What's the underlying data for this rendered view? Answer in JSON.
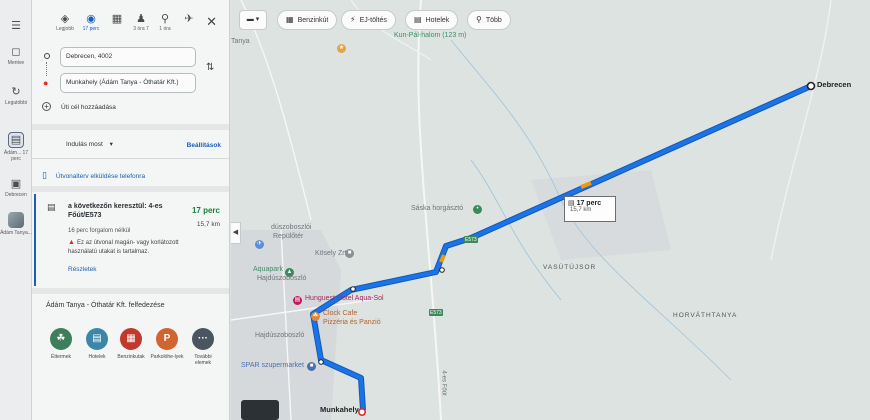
{
  "rail": {
    "items": [
      {
        "icon": "menu-icon",
        "label": ""
      },
      {
        "icon": "bookmark-icon",
        "label": "Mentve"
      },
      {
        "icon": "history-icon",
        "label": "Legutóbbi"
      },
      {
        "icon": "car-icon",
        "label": "Ádám... 17 perc"
      },
      {
        "icon": "car-icon",
        "label": "Debrecen"
      },
      {
        "icon": "thumbnail-icon",
        "label": "Ádám Tanya..."
      }
    ]
  },
  "modes": [
    {
      "icon": "diamond-icon",
      "label": "Legjobb"
    },
    {
      "icon": "car-icon",
      "label": "17 perc"
    },
    {
      "icon": "train-icon",
      "label": ""
    },
    {
      "icon": "walk-icon",
      "label": "3 óra 7"
    },
    {
      "icon": "bike-icon",
      "label": "1 óra"
    },
    {
      "icon": "plane-icon",
      "label": ""
    }
  ],
  "origin": "Debrecen, 4002",
  "destination": "Munkahely (Ádám Tanya - Óthatár Kft.)",
  "add_stop": "Úti cél hozzáadása",
  "depart": "Indulás most",
  "options": "Beállítások",
  "send_to_phone": "Útvonalterv elküldése telefonra",
  "route": {
    "title": "a következőn keresztül: 4-es Főút/E573",
    "time": "17 perc",
    "distance": "15,7 km",
    "traffic": "16 perc forgalom nélkül",
    "warning": "Ez az útvonal magán- vagy korlátozott használatú utakat is tartalmaz.",
    "details": "Részletek"
  },
  "explore": {
    "title": "Ádám Tanya - Óthatár Kft. felfedezése",
    "categories": [
      {
        "label": "Éttermek",
        "icon": "fork-knife-icon",
        "color": "#3f7e5c"
      },
      {
        "label": "Hotelek",
        "icon": "bed-icon",
        "color": "#3b87a8"
      },
      {
        "label": "Benzinkutak",
        "icon": "fuel-icon",
        "color": "#c0392b"
      },
      {
        "label": "Parkolóhe-lyek",
        "icon": "parking-icon",
        "color": "#d2642f"
      },
      {
        "label": "További elemek",
        "icon": "more-icon",
        "color": "#4a5560"
      }
    ]
  },
  "chips": [
    {
      "label": "Benzinkút",
      "icon": "fuel-icon"
    },
    {
      "label": "EJ-töltés",
      "icon": "charger-icon"
    },
    {
      "label": "Hotelek",
      "icon": "bed-icon"
    },
    {
      "label": "Több",
      "icon": "search-icon"
    }
  ],
  "map": {
    "labels": {
      "debrecen": "Debrecen",
      "munkahely": "Munkahely",
      "kun_pal": "Kun-Pál-halom (123 m)",
      "saska": "Sáska horgásztó",
      "dusz": "dúszoboszlói",
      "repuloter": "Repülőtér",
      "kosely": "Kösely Zrt",
      "aquapark": "Aquapark",
      "hajdusz_label": "Hajdúszoboszló",
      "hajduszoboszlo": "Hajdúszoboszló",
      "hunguest": "Hunguest Hotel Aqua-Sol",
      "clock": "Clock Cafe",
      "pizzeria": "Pizzéria és Panzió",
      "spar": "SPAR szupermarket",
      "vasutujsor": "VASÚTÚJSOR",
      "horvathtanya": "HORVÁTHTANYA",
      "e573": "E573",
      "e573b": "E573",
      "ut4": "4-es Főút",
      "tanya": "Tanya"
    },
    "route_card_time": "17 perc",
    "route_card_dist": "15,7 km",
    "route_color": "#1a73e8"
  }
}
